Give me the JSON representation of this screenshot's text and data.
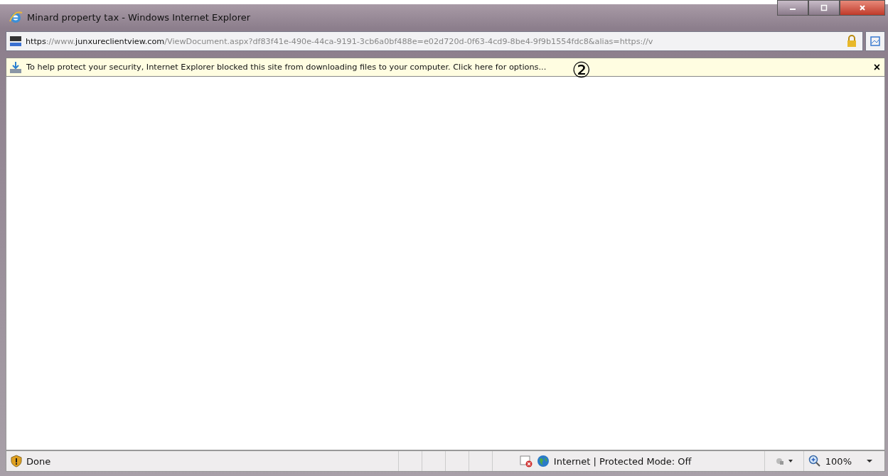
{
  "window": {
    "title": "Minard property tax - Windows Internet Explorer"
  },
  "address_bar": {
    "url": "**https**://www.**junxureclientview.com**/ViewDocument.aspx?df83f41e-490e-44ca-9191-3cb6a0bf488e=e02d720d-0f63-4cd9-8be4-9f9b1554fdc8&alias=https://v"
  },
  "info_bar": {
    "message": "To help protect your security, Internet Explorer blocked this site from downloading files to your computer. Click here for options...",
    "close": "×"
  },
  "annotation": "②",
  "status_bar": {
    "status": "Done",
    "zone": "Internet | Protected Mode: Off",
    "zoom": "100%"
  }
}
